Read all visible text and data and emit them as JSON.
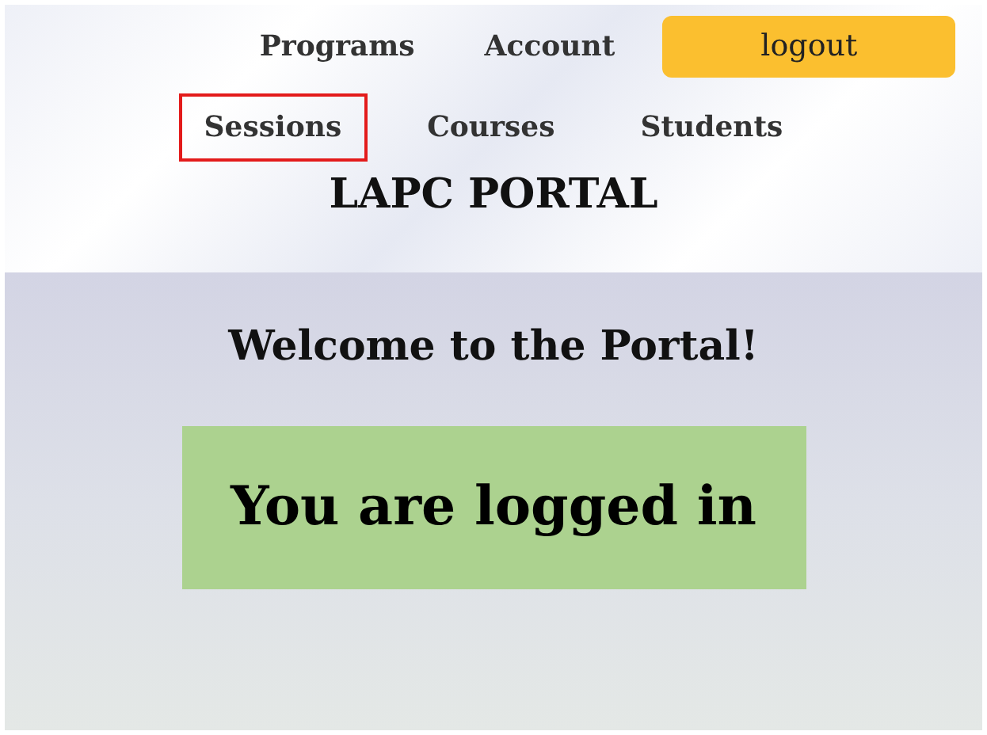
{
  "nav_rows": [
    {
      "items": [
        {
          "label": "Programs",
          "kind": "link",
          "highlighted": false
        },
        {
          "label": "Account",
          "kind": "link",
          "highlighted": false
        },
        {
          "label": "logout",
          "kind": "button",
          "highlighted": false
        }
      ]
    },
    {
      "items": [
        {
          "label": "Sessions",
          "kind": "link",
          "highlighted": true
        },
        {
          "label": "Courses",
          "kind": "link",
          "highlighted": false
        },
        {
          "label": "Students",
          "kind": "link",
          "highlighted": false
        }
      ]
    }
  ],
  "site_title": "LAPC PORTAL",
  "welcome": "Welcome to the Portal!",
  "status_message": "You are logged in"
}
